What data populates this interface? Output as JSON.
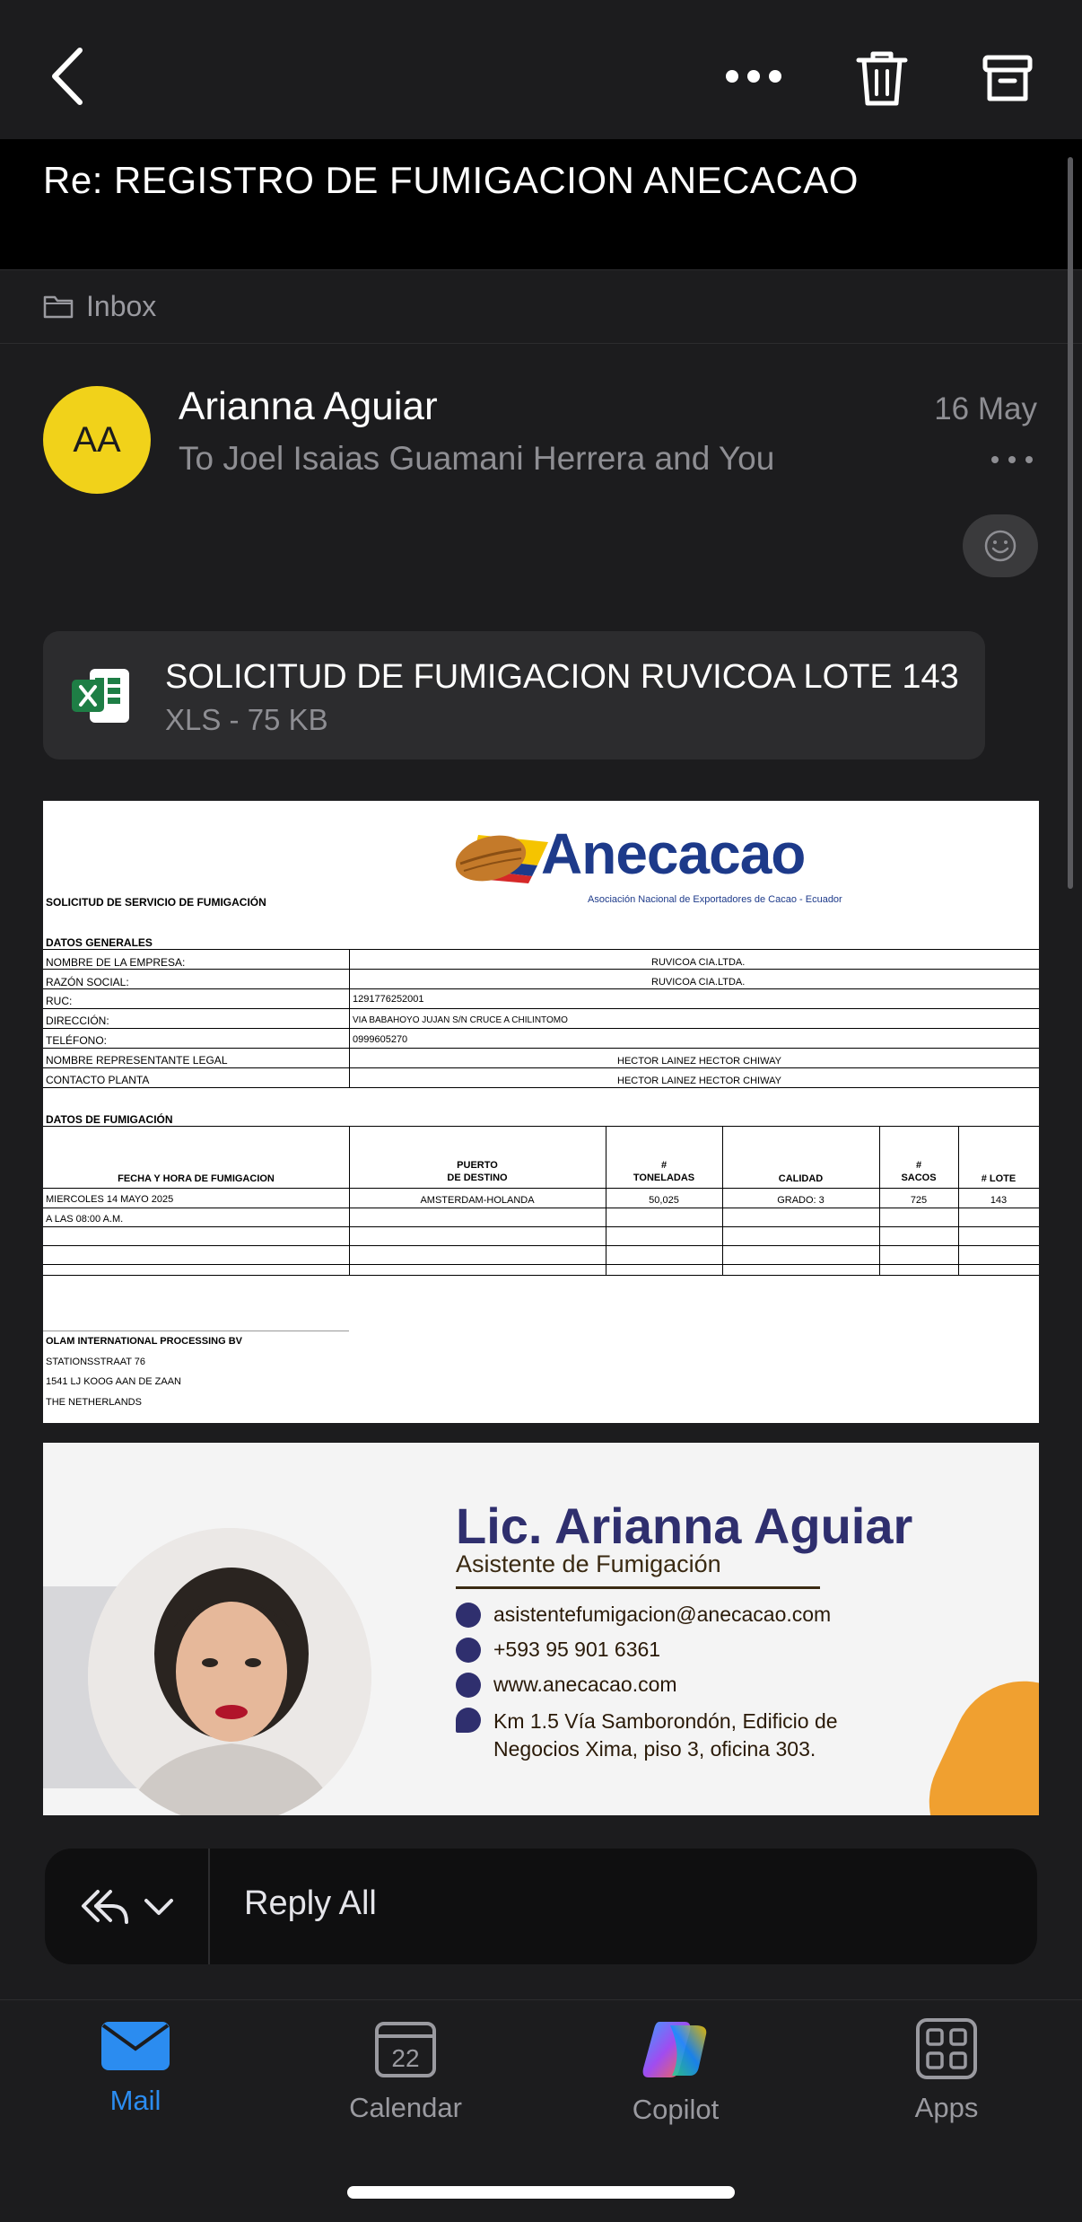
{
  "header": {
    "back_icon": "chevron-left-icon",
    "more_icon": "ellipsis-icon",
    "delete_icon": "trash-icon",
    "archive_icon": "archive-icon"
  },
  "email": {
    "subject": "Re: REGISTRO DE FUMIGACION ANECACAO",
    "folder": "Inbox",
    "sender_initials": "AA",
    "sender_name": "Arianna Aguiar",
    "recipients": "To Joel Isaias Guamani Herrera and You",
    "date": "16 May",
    "avatar_color": "#f1d21a"
  },
  "attachment": {
    "name": "SOLICITUD DE FUMIGACION RUVICOA LOTE 143",
    "meta": "XLS - 75 KB"
  },
  "form": {
    "logo_text": "Anecacao",
    "logo_subtitle": "Asociación Nacional de Exportadores de Cacao - Ecuador",
    "title": "SOLICITUD DE SERVICIO DE FUMIGACIÓN",
    "section_general": "DATOS GENERALES",
    "general_rows": [
      {
        "label": "NOMBRE DE LA EMPRESA:",
        "value": "RUVICOA CIA.LTDA."
      },
      {
        "label": "RAZÓN SOCIAL:",
        "value": "RUVICOA CIA.LTDA."
      },
      {
        "label": "RUC:",
        "value": "1291776252001"
      },
      {
        "label": "DIRECCIÓN:",
        "value": "VIA BABAHOYO JUJAN S/N CRUCE A CHILINTOMO"
      },
      {
        "label": "TELÉFONO:",
        "value": "0999605270"
      },
      {
        "label": "NOMBRE REPRESENTANTE LEGAL",
        "value": "HECTOR LAINEZ HECTOR CHIWAY"
      },
      {
        "label": "CONTACTO PLANTA",
        "value": "HECTOR LAINEZ HECTOR CHIWAY"
      }
    ],
    "section_fumigation": "DATOS DE FUMIGACIÓN",
    "columns": {
      "fecha": "FECHA Y HORA DE FUMIGACION",
      "puerto_1": "PUERTO",
      "puerto_2": "DE DESTINO",
      "ton_1": "#",
      "ton_2": "TONELADAS",
      "calidad": "CALIDAD",
      "sacos_1": "#",
      "sacos_2": "SACOS",
      "lote": "# LOTE"
    },
    "row": {
      "fecha": "MIERCOLES 14 MAYO 2025",
      "hora": "A LAS 08:00 A.M.",
      "puerto": "AMSTERDAM-HOLANDA",
      "toneladas": "50,025",
      "calidad": "GRADO: 3",
      "sacos": "725",
      "lote": "143"
    },
    "consignee": [
      "OLAM INTERNATIONAL PROCESSING BV",
      "STATIONSSTRAAT 76",
      "1541 LJ KOOG AAN DE ZAAN",
      "THE NETHERLANDS"
    ]
  },
  "signature": {
    "name": "Lic. Arianna Aguiar",
    "title": "Asistente de Fumigación",
    "email": "asistentefumigacion@anecacao.com",
    "phone": "+593 95 901 6361",
    "website": "www.anecacao.com",
    "address_1": "Km 1.5 Vía Samborondón, Edificio de",
    "address_2": "Negocios Xima, piso 3, oficina 303."
  },
  "reply": {
    "label": "Reply All",
    "icon": "reply-all-icon"
  },
  "tabs": [
    {
      "label": "Mail",
      "icon": "mail-icon",
      "active": true
    },
    {
      "label": "Calendar",
      "icon": "calendar-icon",
      "badge": "22"
    },
    {
      "label": "Copilot",
      "icon": "copilot-icon"
    },
    {
      "label": "Apps",
      "icon": "apps-grid-icon"
    }
  ],
  "colors": {
    "accent": "#2b8cf0",
    "background": "#1c1c1e",
    "brand_blue": "#1d3a8a"
  }
}
